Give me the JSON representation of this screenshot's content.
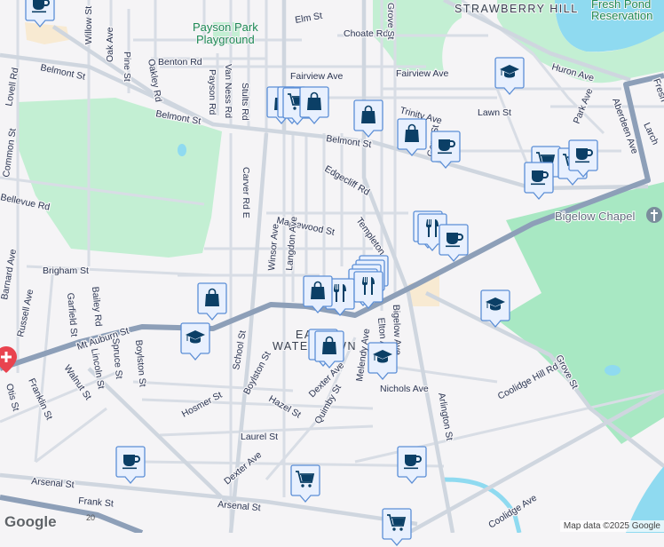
{
  "map": {
    "neighborhoods": [
      "STRAWBERRY HILL",
      "EAST",
      "WATERTOWN"
    ],
    "parks": [
      "Payson Park",
      "Playground",
      "Fresh Pond",
      "Reservation"
    ],
    "pois": [
      "Bigelow Chapel"
    ],
    "streets": [
      "Elm St",
      "Choate Rd",
      "Benton Rd",
      "Fairview Ave",
      "Fairview Ave",
      "Huron Ave",
      "Lawn St",
      "Belmont St",
      "Belmont St",
      "Belmont St",
      "Willow St",
      "Oak Ave",
      "Pine St",
      "Oakley Rd",
      "Payson Rd",
      "Van Ness Rd",
      "Stults Rd",
      "Lovell Rd",
      "Common St",
      "Bellevue Rd",
      "Carver Rd E",
      "Maplewood St",
      "Edgecliff Rd",
      "Templeton",
      "Winsor Ave",
      "Langdon Ave",
      "Brigham St",
      "Barnard Ave",
      "Russell Ave",
      "Garfield St",
      "Bailey Rd",
      "Mt Auburn St",
      "Lincoln St",
      "Spruce St",
      "Boylston St",
      "Boylston St",
      "School St",
      "Walnut St",
      "Franklin St",
      "Otis St",
      "Hosmer St",
      "Hazel St",
      "Dexter Ave",
      "Dexter Ave",
      "Quimby St",
      "Laurel St",
      "Melendy Ave",
      "Elton Ave",
      "Bigelow Ave",
      "Nichols Ave",
      "Arlington St",
      "Coolidge Hill Rd",
      "Grove St",
      "Grove St",
      "Coolidge Ave",
      "Arsenal St",
      "Arsenal St",
      "Frank St",
      "Park Ave",
      "Aberdeen Ave",
      "Trinity Ave",
      "Gore St",
      "20",
      "Larch",
      "Fresh"
    ],
    "markers": [
      "coffee",
      "shopping",
      "shopping",
      "cart",
      "shopping",
      "shopping",
      "shopping",
      "coffee",
      "education",
      "cart",
      "cart",
      "coffee",
      "coffee",
      "restaurant",
      "restaurant",
      "coffee",
      "restaurant",
      "restaurant",
      "restaurant",
      "restaurant",
      "restaurant",
      "shopping",
      "restaurant",
      "shopping",
      "education",
      "shopping",
      "shopping",
      "education",
      "education",
      "coffee",
      "coffee",
      "cart",
      "cart",
      "hospital",
      "chapel"
    ]
  },
  "footer": {
    "logo": "Google",
    "attribution": "Map data ©2025 Google"
  },
  "colors": {
    "marker_fill": "#e8f0fe",
    "marker_border": "#5b8ed6",
    "icon": "#0b3f66",
    "park": "#c3efd3",
    "water": "#8fdaf0",
    "major_road": "#8d9fb8"
  }
}
